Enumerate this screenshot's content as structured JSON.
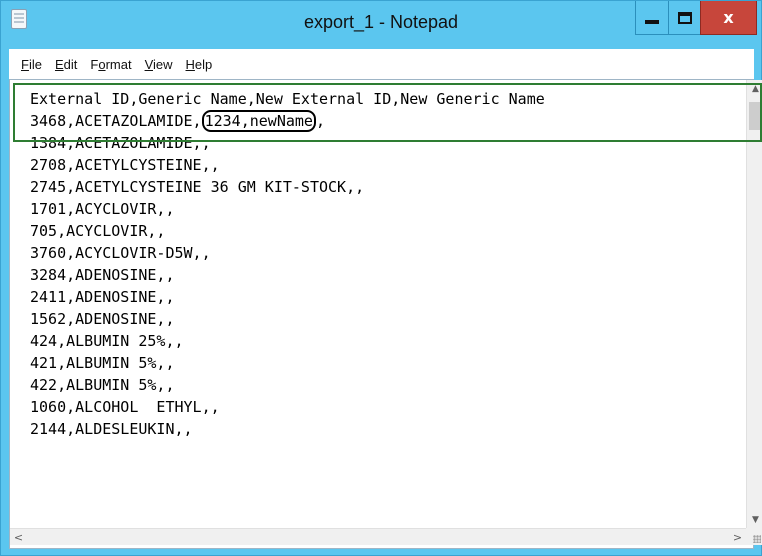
{
  "window": {
    "title": "export_1 - Notepad",
    "controls": {
      "minimize": "minimize",
      "maximize": "maximize",
      "close": "x"
    }
  },
  "menu": [
    {
      "underlined": "F",
      "rest": "ile"
    },
    {
      "underlined": "E",
      "rest": "dit"
    },
    {
      "underlined": "",
      "pre": "F",
      "underlined2": "o",
      "rest": "rmat"
    },
    {
      "underlined": "V",
      "rest": "iew"
    },
    {
      "underlined": "H",
      "rest": "elp"
    }
  ],
  "menu_labels": [
    "File",
    "Edit",
    "Format",
    "View",
    "Help"
  ],
  "document": {
    "header_line": "External ID,Generic Name,New External ID,New Generic Name",
    "second_line": {
      "prefix": "3468,ACETAZOLAMIDE,",
      "circled": "1234,newName",
      "suffix": ","
    },
    "lines": [
      "1384,ACETAZOLAMIDE,,",
      "2708,ACETYLCYSTEINE,,",
      "2745,ACETYLCYSTEINE 36 GM KIT-STOCK,,",
      "1701,ACYCLOVIR,,",
      "705,ACYCLOVIR,,",
      "3760,ACYCLOVIR-D5W,,",
      "3284,ADENOSINE,,",
      "2411,ADENOSINE,,",
      "1562,ADENOSINE,,",
      "424,ALBUMIN 25%,,",
      "421,ALBUMIN 5%,,",
      "422,ALBUMIN 5%,,",
      "1060,ALCOHOL  ETHYL,,",
      "2144,ALDESLEUKIN,,"
    ]
  },
  "scrollbars": {
    "up": "▲",
    "down": "▼",
    "left": "<",
    "right": ">"
  },
  "colors": {
    "titlebar": "#5bc6ef",
    "close_button": "#c7463b",
    "highlight_box": "#2e7d32"
  },
  "icons": {
    "app": "notepad-icon",
    "minimize": "minimize-icon",
    "maximize": "maximize-icon",
    "close": "close-icon"
  }
}
